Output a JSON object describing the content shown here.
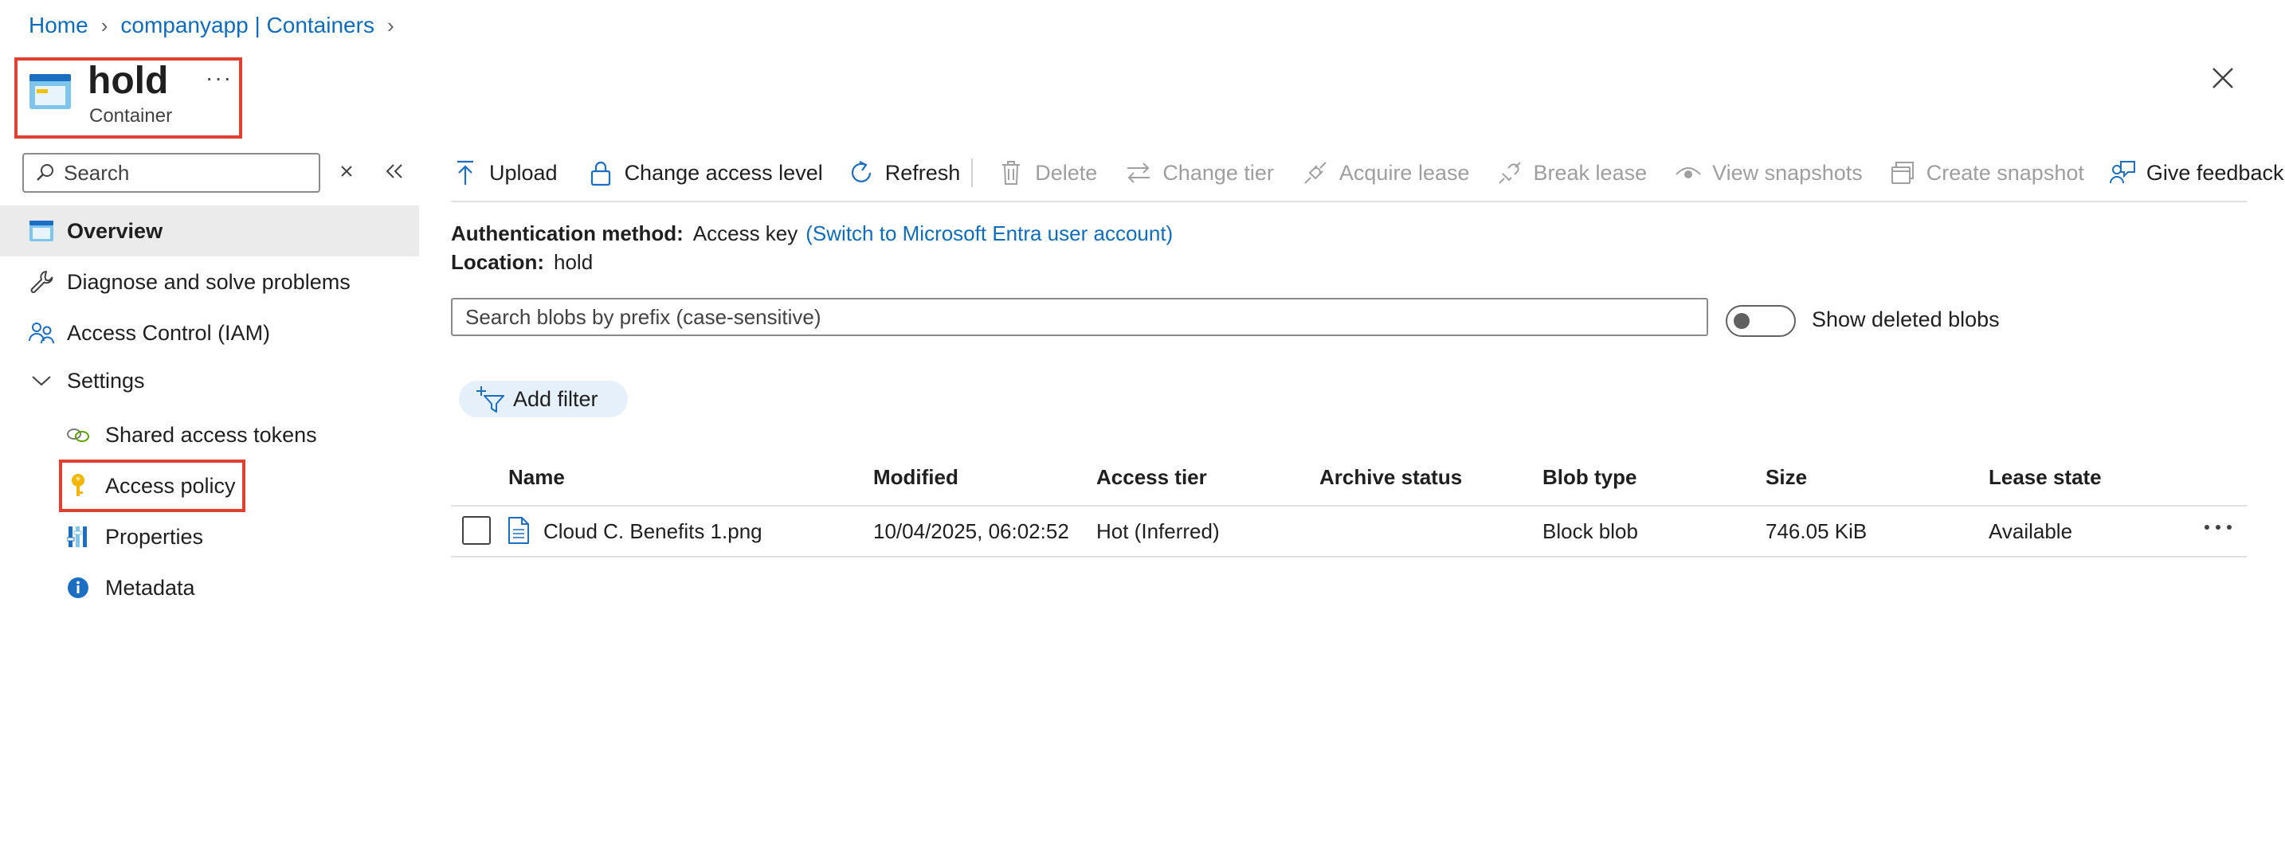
{
  "breadcrumb": {
    "items": [
      "Home",
      "companyapp | Containers"
    ],
    "sep": "›"
  },
  "header": {
    "title": "hold",
    "subtitle": "Container",
    "more": "···"
  },
  "sidebar": {
    "search_placeholder": "Search",
    "items": [
      {
        "label": "Overview",
        "icon": "container-icon",
        "active": true
      },
      {
        "label": "Diagnose and solve problems",
        "icon": "wrench-icon"
      },
      {
        "label": "Access Control (IAM)",
        "icon": "people-icon"
      },
      {
        "label": "Settings",
        "icon": "chevron-down-icon",
        "expanded": true
      },
      {
        "label": "Shared access tokens",
        "icon": "link-icon"
      },
      {
        "label": "Access policy",
        "icon": "key-icon"
      },
      {
        "label": "Properties",
        "icon": "properties-icon"
      },
      {
        "label": "Metadata",
        "icon": "info-icon"
      }
    ]
  },
  "toolbar": {
    "upload": "Upload",
    "change_access_level": "Change access level",
    "refresh": "Refresh",
    "delete": "Delete",
    "change_tier": "Change tier",
    "acquire_lease": "Acquire lease",
    "break_lease": "Break lease",
    "view_snapshots": "View snapshots",
    "create_snapshot": "Create snapshot",
    "give_feedback": "Give feedback"
  },
  "info": {
    "auth_key": "Authentication method:",
    "auth_value": "Access key",
    "auth_link": "(Switch to Microsoft Entra user account)",
    "location_key": "Location:",
    "location_value": "hold"
  },
  "blob_search": {
    "placeholder": "Search blobs by prefix (case-sensitive)"
  },
  "show_deleted": {
    "label": "Show deleted blobs",
    "on": false
  },
  "filter": {
    "label": "Add filter"
  },
  "table": {
    "columns": [
      "Name",
      "Modified",
      "Access tier",
      "Archive status",
      "Blob type",
      "Size",
      "Lease state"
    ],
    "rows": [
      {
        "name": "Cloud C. Benefits 1.png",
        "modified": "10/04/2025, 06:02:52",
        "access_tier": "Hot (Inferred)",
        "archive_status": "",
        "blob_type": "Block blob",
        "size": "746.05 KiB",
        "lease_state": "Available"
      }
    ]
  },
  "colors": {
    "link": "#0f6cbd",
    "highlight_box": "#e04030",
    "active_bg": "#ebebeb",
    "filter_pill_bg": "#e6f0fa"
  }
}
